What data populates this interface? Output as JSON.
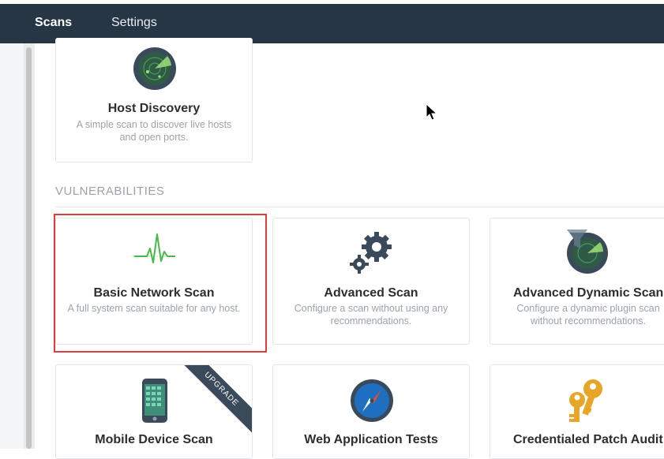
{
  "nav": {
    "tabs": [
      {
        "label": "Scans",
        "active": true
      },
      {
        "label": "Settings",
        "active": false
      }
    ]
  },
  "templates": {
    "host_discovery": {
      "title": "Host Discovery",
      "description": "A simple scan to discover live hosts and open ports.",
      "icon": "radar-icon"
    },
    "section_heading": "VULNERABILITIES",
    "basic_network_scan": {
      "title": "Basic Network Scan",
      "description": "A full system scan suitable for any host.",
      "icon": "pulse-icon",
      "highlighted": true
    },
    "advanced_scan": {
      "title": "Advanced Scan",
      "description": "Configure a scan without using any recommendations.",
      "icon": "gears-icon"
    },
    "advanced_dynamic_scan": {
      "title": "Advanced Dynamic Scan",
      "description": "Configure a dynamic plugin scan without recommendations.",
      "icon": "radar-filter-icon"
    },
    "mobile_device_scan": {
      "title": "Mobile Device Scan",
      "badge": "UPGRADE",
      "icon": "mobile-phone-icon"
    },
    "web_application_tests": {
      "title": "Web Application Tests",
      "icon": "compass-icon"
    },
    "credentialed_patch_audit": {
      "title": "Credentialed Patch Audit",
      "icon": "keys-icon"
    }
  },
  "colors": {
    "navbar": "#263645",
    "accent_green": "#44bb44",
    "highlight_red": "#e03c3c",
    "icon_dark": "#3a4a5a"
  }
}
